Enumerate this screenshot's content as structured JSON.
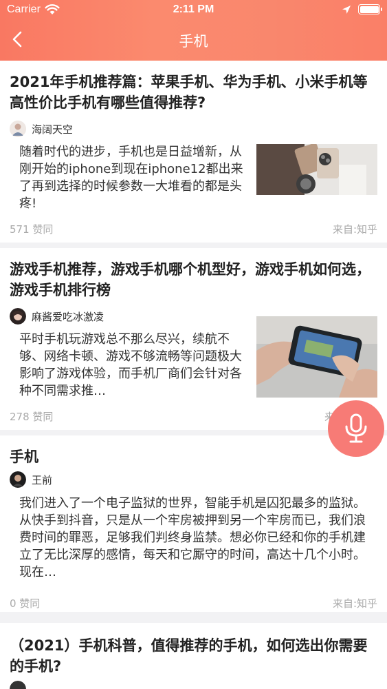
{
  "status_bar": {
    "carrier": "Carrier",
    "time": "2:11 PM"
  },
  "nav": {
    "title": "手机",
    "back_icon": "chevron-left-icon"
  },
  "colors": {
    "header_gradient_start": "#f97862",
    "header_gradient_end": "#fa7f67",
    "mic_button": "#f77b76",
    "meta_text": "#aaaaaa"
  },
  "articles": [
    {
      "title": "2021年手机推荐篇：苹果手机、华为手机、小米手机等高性价比手机有哪些值得推荐?",
      "author": "海阔天空",
      "excerpt": "随着时代的进步，手机也是日益增新，从刚开始的iphone到现在iphone12都出来了再到选择的时候参数一大堆看的都是头疼!",
      "likes": "571 赞同",
      "source": "来自:知乎"
    },
    {
      "title": "游戏手机推荐，游戏手机哪个机型好，游戏手机如何选，游戏手机排行榜",
      "author": "麻酱爱吃冰激凌",
      "excerpt": "平时手机玩游戏总不那么尽兴，续航不够、网络卡顿、游戏不够流畅等问题极大影响了游戏体验，而手机厂商们会针对各种不同需求推…",
      "likes": "278 赞同",
      "source": "来"
    },
    {
      "title": "手机",
      "author": "王前",
      "excerpt": "我们进入了一个电子监狱的世界，智能手机是囚犯最多的监狱。从快手到抖音，只是从一个牢房被押到另一个牢房而已，我们浪费时间的罪恶，足够我们判终身监禁。想必你已经和你的手机建立了无比深厚的感情，每天和它厮守的时间，高达十几个小时。现在…",
      "likes": "0 赞同",
      "source": "来自:知乎"
    },
    {
      "title": "（2021）手机科普，值得推荐的手机，如何选出你需要的手机?",
      "author": ""
    }
  ],
  "mic_button": {
    "icon": "microphone-icon"
  }
}
